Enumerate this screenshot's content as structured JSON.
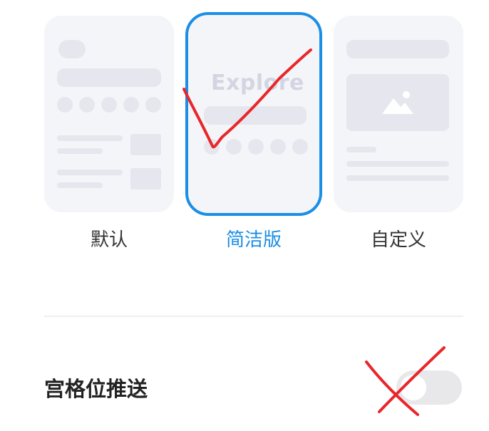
{
  "layouts": {
    "default": {
      "label": "默认",
      "selected": false
    },
    "simple": {
      "label": "简洁版",
      "preview_text": "Explore",
      "selected": true
    },
    "custom": {
      "label": "自定义",
      "selected": false
    }
  },
  "settings": {
    "grid_push": {
      "label": "宫格位推送",
      "enabled": false
    }
  },
  "colors": {
    "accent": "#1b8ee5",
    "annotation": "#e8262b"
  }
}
